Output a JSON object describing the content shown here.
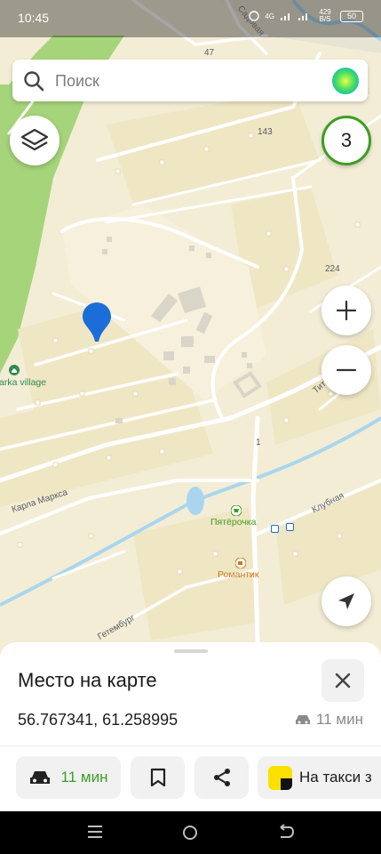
{
  "status_bar": {
    "time": "10:45",
    "network": "4G",
    "data_speed": "429 B/S",
    "battery": "50"
  },
  "search": {
    "placeholder": "Поиск"
  },
  "layers_badge": {
    "count": "3"
  },
  "map": {
    "streets": [
      "Карла Маркса",
      "Клубная",
      "Садовая",
      "Тит",
      "Гетембург"
    ],
    "house_numbers": [
      "47",
      "143",
      "224",
      "1"
    ],
    "pois": [
      {
        "name": "Пятёрочка",
        "color": "#3c9e1f"
      },
      {
        "name": "Романтик",
        "color": "#c8781a"
      },
      {
        "name": "Sarka village",
        "color": "#2f8a4e"
      }
    ],
    "colors": {
      "land": "#f3edd6",
      "forest": "#a6d47a",
      "water": "#a9d6ee",
      "pin": "#1b6ed8"
    }
  },
  "place_card": {
    "title": "Место на карте",
    "coordinates": "56.767341, 61.258995",
    "drive_time": "11 мин",
    "route_button_label": "11 мин",
    "taxi_label": "На такси з",
    "accent_color": "#3b9e27"
  }
}
